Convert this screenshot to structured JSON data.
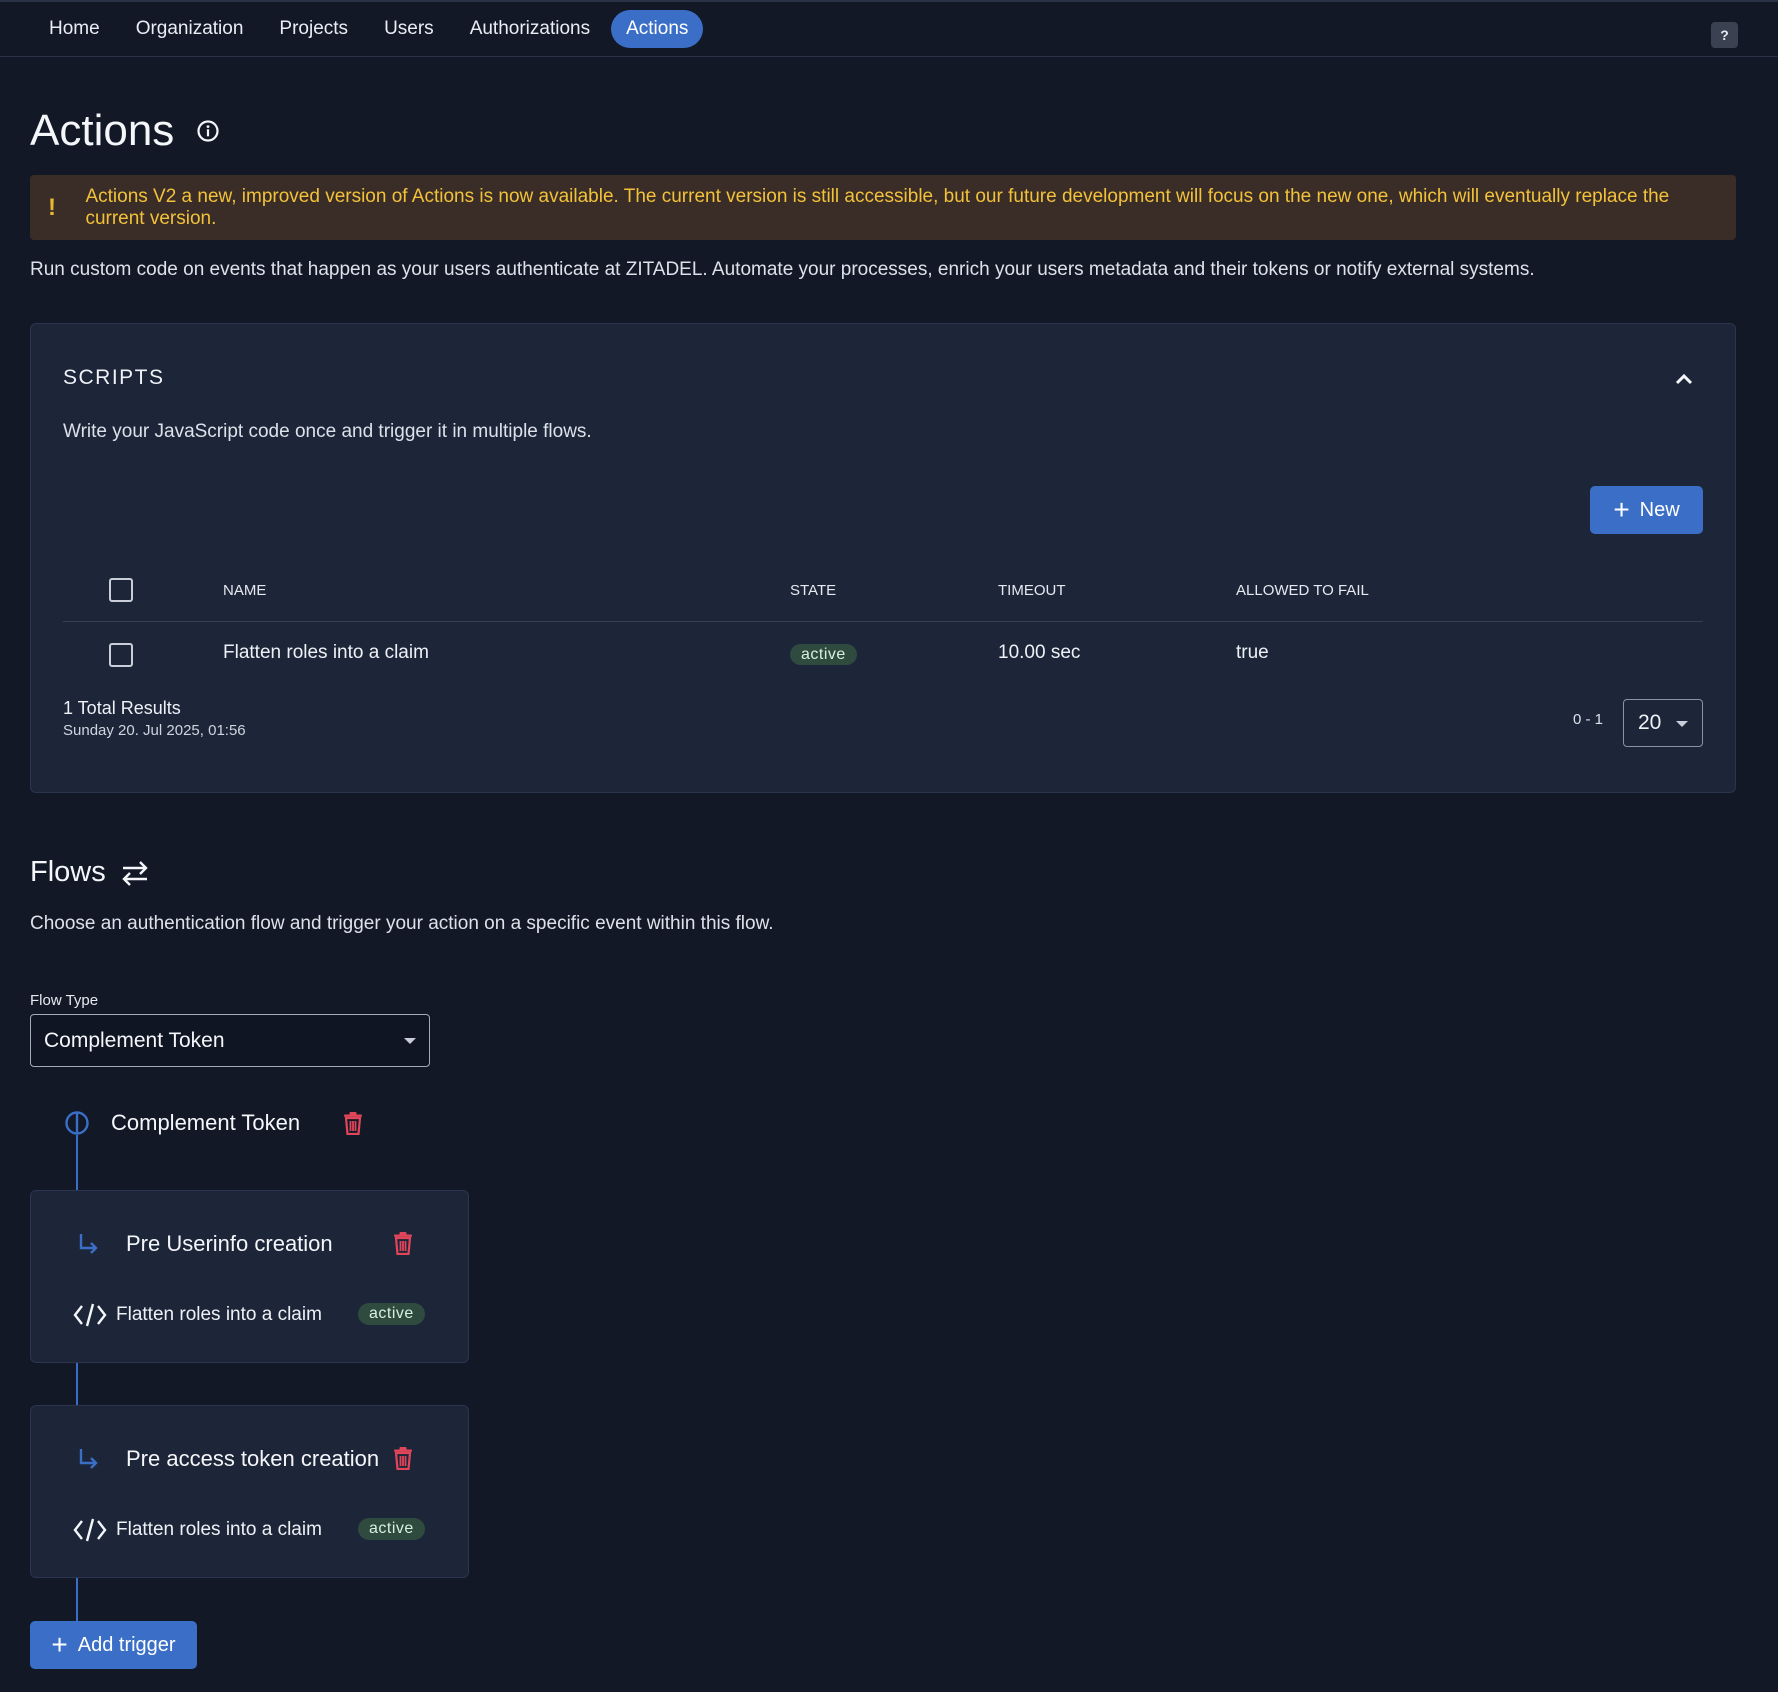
{
  "nav": {
    "items": [
      "Home",
      "Organization",
      "Projects",
      "Users",
      "Authorizations",
      "Actions"
    ],
    "active": "Actions",
    "help_label": "?"
  },
  "page": {
    "title": "Actions",
    "warning": "Actions V2 a new, improved version of Actions is now available. The current version is still accessible, but our future development will focus on the new one, which will eventually replace the current version.",
    "warning_mark": "!",
    "description": "Run custom code on events that happen as your users authenticate at ZITADEL. Automate your processes, enrich your users metadata and their tokens or notify external systems."
  },
  "scripts": {
    "title": "SCRIPTS",
    "description": "Write your JavaScript code once and trigger it in multiple flows.",
    "new_label": "New",
    "columns": [
      "NAME",
      "STATE",
      "TIMEOUT",
      "ALLOWED TO FAIL"
    ],
    "rows": [
      {
        "name": "Flatten roles into a claim",
        "state": "active",
        "timeout": "10.00 sec",
        "allowed_to_fail": "true"
      }
    ],
    "total_results": "1 Total Results",
    "timestamp": "Sunday 20. Jul 2025, 01:56",
    "range": "0 - 1",
    "page_size": "20"
  },
  "flows": {
    "title": "Flows",
    "description": "Choose an authentication flow and trigger your action on a specific event within this flow.",
    "flow_type_label": "Flow Type",
    "flow_type_value": "Complement Token",
    "flow_name": "Complement Token",
    "triggers": [
      {
        "title": "Pre Userinfo creation",
        "script": "Flatten roles into a claim",
        "state": "active"
      },
      {
        "title": "Pre access token creation",
        "script": "Flatten roles into a claim",
        "state": "active"
      }
    ],
    "add_trigger_label": "Add trigger"
  },
  "colors": {
    "background": "#121826",
    "card": "#1d2538",
    "accent": "#3b6fc7",
    "danger": "#e0455a",
    "warning_text": "#f2c23a"
  }
}
